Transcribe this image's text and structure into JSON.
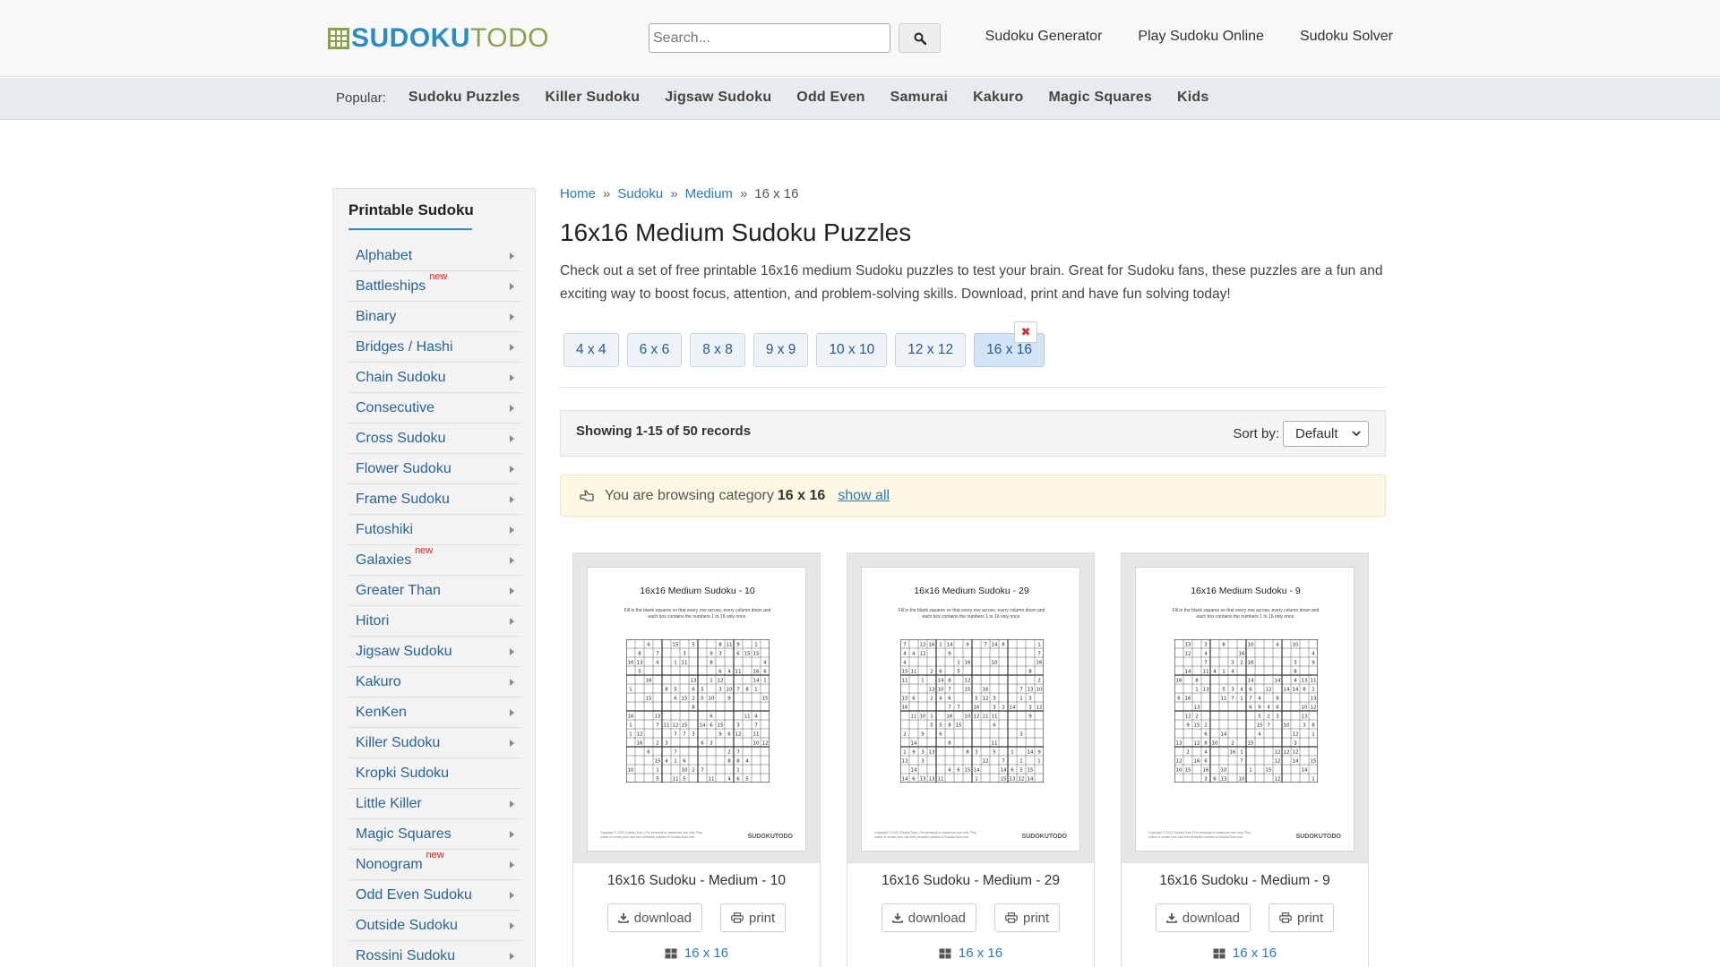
{
  "header": {
    "logo_bold": "SUDOKU",
    "logo_light": "TODO",
    "search_placeholder": "Search...",
    "nav": [
      "Sudoku Generator",
      "Play Sudoku Online",
      "Sudoku Solver"
    ]
  },
  "popular": {
    "label": "Popular:",
    "links": [
      "Sudoku Puzzles",
      "Killer Sudoku",
      "Jigsaw Sudoku",
      "Odd Even",
      "Samurai",
      "Kakuro",
      "Magic Squares",
      "Kids"
    ]
  },
  "sidebar": {
    "title": "Printable Sudoku",
    "new_label": "new",
    "items": [
      {
        "label": "Alphabet",
        "new": false,
        "caret": true
      },
      {
        "label": "Battleships",
        "new": true,
        "caret": true
      },
      {
        "label": "Binary",
        "new": false,
        "caret": true
      },
      {
        "label": "Bridges / Hashi",
        "new": false,
        "caret": true
      },
      {
        "label": "Chain Sudoku",
        "new": false,
        "caret": true
      },
      {
        "label": "Consecutive",
        "new": false,
        "caret": true
      },
      {
        "label": "Cross Sudoku",
        "new": false,
        "caret": true
      },
      {
        "label": "Flower Sudoku",
        "new": false,
        "caret": true
      },
      {
        "label": "Frame Sudoku",
        "new": false,
        "caret": true
      },
      {
        "label": "Futoshiki",
        "new": false,
        "caret": true
      },
      {
        "label": "Galaxies",
        "new": true,
        "caret": true
      },
      {
        "label": "Greater Than",
        "new": false,
        "caret": true
      },
      {
        "label": "Hitori",
        "new": false,
        "caret": true
      },
      {
        "label": "Jigsaw Sudoku",
        "new": false,
        "caret": true
      },
      {
        "label": "Kakuro",
        "new": false,
        "caret": true
      },
      {
        "label": "KenKen",
        "new": false,
        "caret": true
      },
      {
        "label": "Killer Sudoku",
        "new": false,
        "caret": true
      },
      {
        "label": "Kropki Sudoku",
        "new": false,
        "caret": false
      },
      {
        "label": "Little Killer",
        "new": false,
        "caret": true
      },
      {
        "label": "Magic Squares",
        "new": false,
        "caret": true
      },
      {
        "label": "Nonogram",
        "new": true,
        "caret": true
      },
      {
        "label": "Odd Even Sudoku",
        "new": false,
        "caret": true
      },
      {
        "label": "Outside Sudoku",
        "new": false,
        "caret": true
      },
      {
        "label": "Rossini Sudoku",
        "new": false,
        "caret": true
      }
    ]
  },
  "breadcrumb": {
    "items": [
      "Home",
      "Sudoku",
      "Medium"
    ],
    "current": "16 x 16",
    "separator": "»"
  },
  "main": {
    "title": "16x16 Medium Sudoku Puzzles",
    "intro": "Check out a set of free printable 16x16 medium Sudoku puzzles to test your brain. Great for Sudoku fans, these puzzles are a fun and exciting way to boost focus, attention, and problem-solving skills. Download, print and have fun solving today!",
    "sizes": [
      "4 x 4",
      "6 x 6",
      "8 x 8",
      "9 x 9",
      "10 x 10",
      "12 x 12",
      "16 x 16"
    ],
    "active_size": "16 x 16",
    "records": "Showing 1-15 of 50 records",
    "sort_label": "Sort by:",
    "sort_value": "Default",
    "browsing_prefix": "You are browsing category",
    "browsing_category": "16 x 16",
    "show_all": "show all"
  },
  "cards": [
    {
      "sheet_title": "16x16 Medium Sudoku - 10",
      "title": "16x16 Sudoku - Medium - 10",
      "category": "16 x 16"
    },
    {
      "sheet_title": "16x16 Medium Sudoku - 29",
      "title": "16x16 Sudoku - Medium - 29",
      "category": "16 x 16"
    },
    {
      "sheet_title": "16x16 Medium Sudoku - 9",
      "title": "16x16 Sudoku - Medium - 9",
      "category": "16 x 16"
    }
  ],
  "card_labels": {
    "download": "download",
    "print": "print",
    "sheet_instructions": "Fill in the blank squares so that every row across, every column down and each box contains the numbers 1 to 16 only once.",
    "sheet_footer": "Copyright © 2022 SudokuTodo | For personal or classroom use only. Play online or create your own free printable puzzles at SudokuTodo.com",
    "sheet_logo": "SUDOKUTODO"
  },
  "colors": {
    "brand_blue": "#2b8cc4",
    "brand_green": "#8aa24a",
    "link": "#2a6496",
    "new_badge": "#d9231d",
    "close_red": "#c9302c"
  }
}
